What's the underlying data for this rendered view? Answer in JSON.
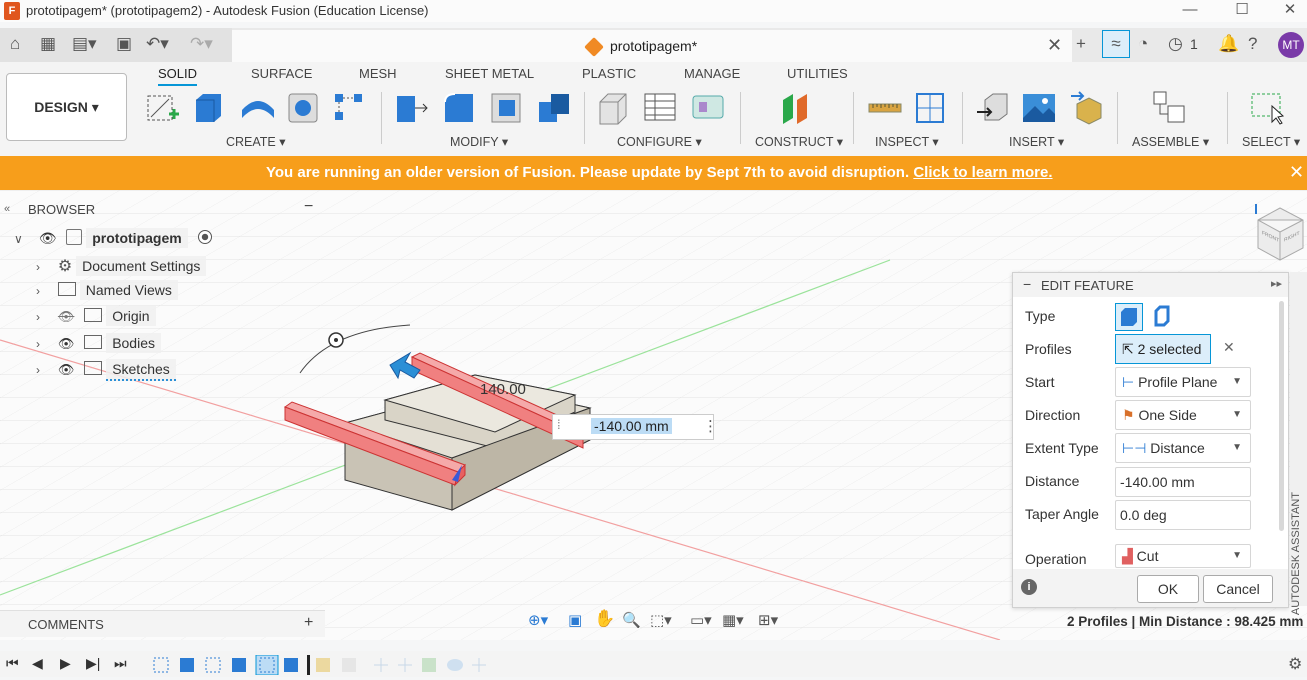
{
  "window": {
    "title": "prototipagem* (prototipagem2) - Autodesk Fusion (Education License)",
    "logo_letter": "F"
  },
  "tabbar": {
    "doc_tab_name": "prototipagem*",
    "job_count": "1",
    "avatar_initials": "MT"
  },
  "toolbar": {
    "design_button": "DESIGN ▾",
    "workspace_tabs": [
      "SOLID",
      "SURFACE",
      "MESH",
      "SHEET METAL",
      "PLASTIC",
      "MANAGE",
      "UTILITIES"
    ],
    "groups": [
      "CREATE ▾",
      "MODIFY ▾",
      "CONFIGURE ▾",
      "CONSTRUCT ▾",
      "INSPECT ▾",
      "INSERT ▾",
      "ASSEMBLE ▾",
      "SELECT ▾"
    ]
  },
  "banner": {
    "message": "You are running an older version of Fusion. Please update by Sept 7th to avoid disruption.",
    "link": "Click to learn more."
  },
  "browser": {
    "title": "BROWSER",
    "root": "prototipagem",
    "items": [
      "Document Settings",
      "Named Views",
      "Origin",
      "Bodies",
      "Sketches"
    ]
  },
  "comments": {
    "title": "COMMENTS"
  },
  "viewport": {
    "dimension_label": "140.00",
    "dimension_input": "-140.00 mm",
    "axis_front": "FRONT",
    "axis_right": "RIGHT"
  },
  "edit_feature": {
    "title": "EDIT FEATURE",
    "rows": {
      "type_label": "Type",
      "profiles_label": "Profiles",
      "profiles_value": "2 selected",
      "start_label": "Start",
      "start_value": "Profile Plane",
      "direction_label": "Direction",
      "direction_value": "One Side",
      "extent_label": "Extent Type",
      "extent_value": "Distance",
      "distance_label": "Distance",
      "distance_value": "-140.00 mm",
      "taper_label": "Taper Angle",
      "taper_value": "0.0 deg",
      "operation_label": "Operation",
      "operation_value": "Cut"
    },
    "ok": "OK",
    "cancel": "Cancel"
  },
  "status": {
    "text": "2 Profiles | Min Distance : 98.425 mm"
  },
  "assistant_label": "AUTODESK ASSISTANT",
  "colors": {
    "accent": "#0696d7",
    "banner": "#f79e1b",
    "avatar": "#7a3aa8",
    "cut_preview": "#f08080"
  }
}
